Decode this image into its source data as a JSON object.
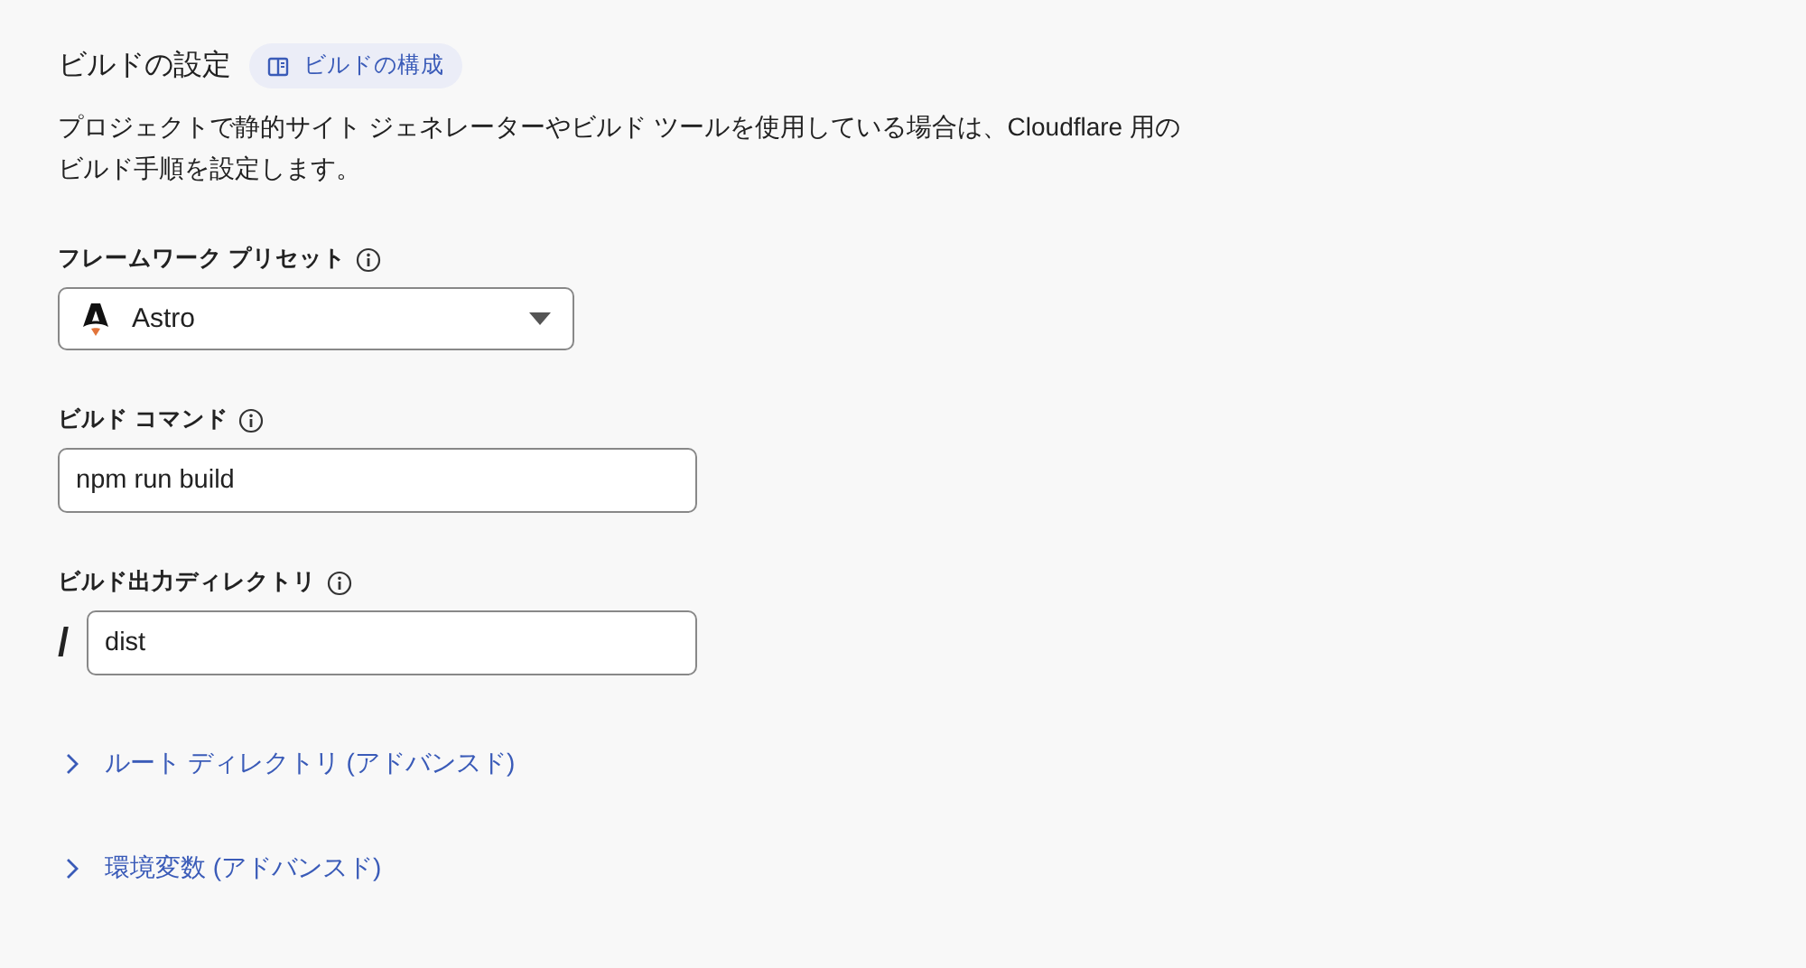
{
  "heading": {
    "title": "ビルドの設定",
    "badge": "ビルドの構成"
  },
  "description": "プロジェクトで静的サイト ジェネレーターやビルド ツールを使用している場合は、Cloudflare 用のビルド手順を設定します。",
  "fields": [
    {
      "kind": "select",
      "label": "フレームワーク プリセット",
      "value": "Astro"
    },
    {
      "kind": "text",
      "label": "ビルド コマンド",
      "value": "npm run build"
    },
    {
      "kind": "prefixed",
      "label": "ビルド出力ディレクトリ",
      "prefix": "/",
      "value": "dist"
    }
  ],
  "expanders": [
    {
      "label": "ルート ディレクトリ (アドバンスド)",
      "expanded": false
    },
    {
      "label": "環境変数 (アドバンスド)",
      "expanded": false
    }
  ]
}
